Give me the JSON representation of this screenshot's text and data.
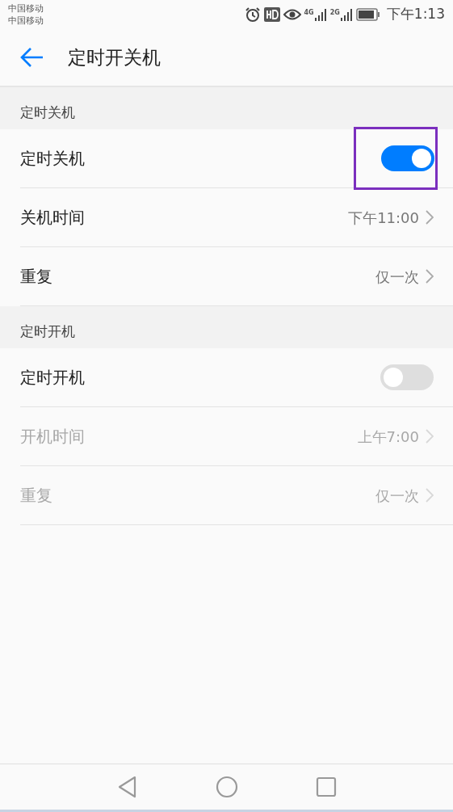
{
  "status_bar": {
    "carriers": [
      "中国移动",
      "中国移动"
    ],
    "networks": [
      "4G",
      "2G"
    ],
    "time": "下午1:13"
  },
  "header": {
    "title": "定时开关机"
  },
  "sections": [
    {
      "title": "定时关机",
      "items": [
        {
          "kind": "switch",
          "label": "定时关机",
          "on": true,
          "disabled": false,
          "highlighted": true
        },
        {
          "kind": "link",
          "label": "关机时间",
          "value": "下午11:00",
          "disabled": false
        },
        {
          "kind": "link",
          "label": "重复",
          "value": "仅一次",
          "disabled": false
        }
      ]
    },
    {
      "title": "定时开机",
      "items": [
        {
          "kind": "switch",
          "label": "定时开机",
          "on": false,
          "disabled": false,
          "highlighted": false
        },
        {
          "kind": "link",
          "label": "开机时间",
          "value": "上午7:00",
          "disabled": true
        },
        {
          "kind": "link",
          "label": "重复",
          "value": "仅一次",
          "disabled": true
        }
      ]
    }
  ]
}
